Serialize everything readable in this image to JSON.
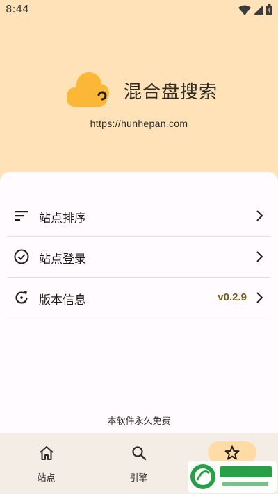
{
  "status_bar": {
    "time": "8:44"
  },
  "app": {
    "name": "混合盘搜索",
    "url": "https://hunhepan.com"
  },
  "menu": [
    {
      "label": "站点排序",
      "icon": "sort-icon"
    },
    {
      "label": "站点登录",
      "icon": "check-circle-icon"
    },
    {
      "label": "版本信息",
      "icon": "refresh-icon",
      "value": "v0.2.9"
    }
  ],
  "footer_note": "本软件永久免费",
  "bottom_nav": [
    {
      "label": "站点",
      "icon": "home-icon"
    },
    {
      "label": "引擎",
      "icon": "search-icon"
    },
    {
      "label": "",
      "icon": "star-icon",
      "active": true
    }
  ],
  "watermark": {
    "text": "飞翔下载",
    "subtext": "www.fxxz.com"
  },
  "colors": {
    "header_bg": "#ffe2b8",
    "accent": "#fbb735",
    "version_text": "#7a5a15",
    "nav_active": "#ffdba6"
  }
}
